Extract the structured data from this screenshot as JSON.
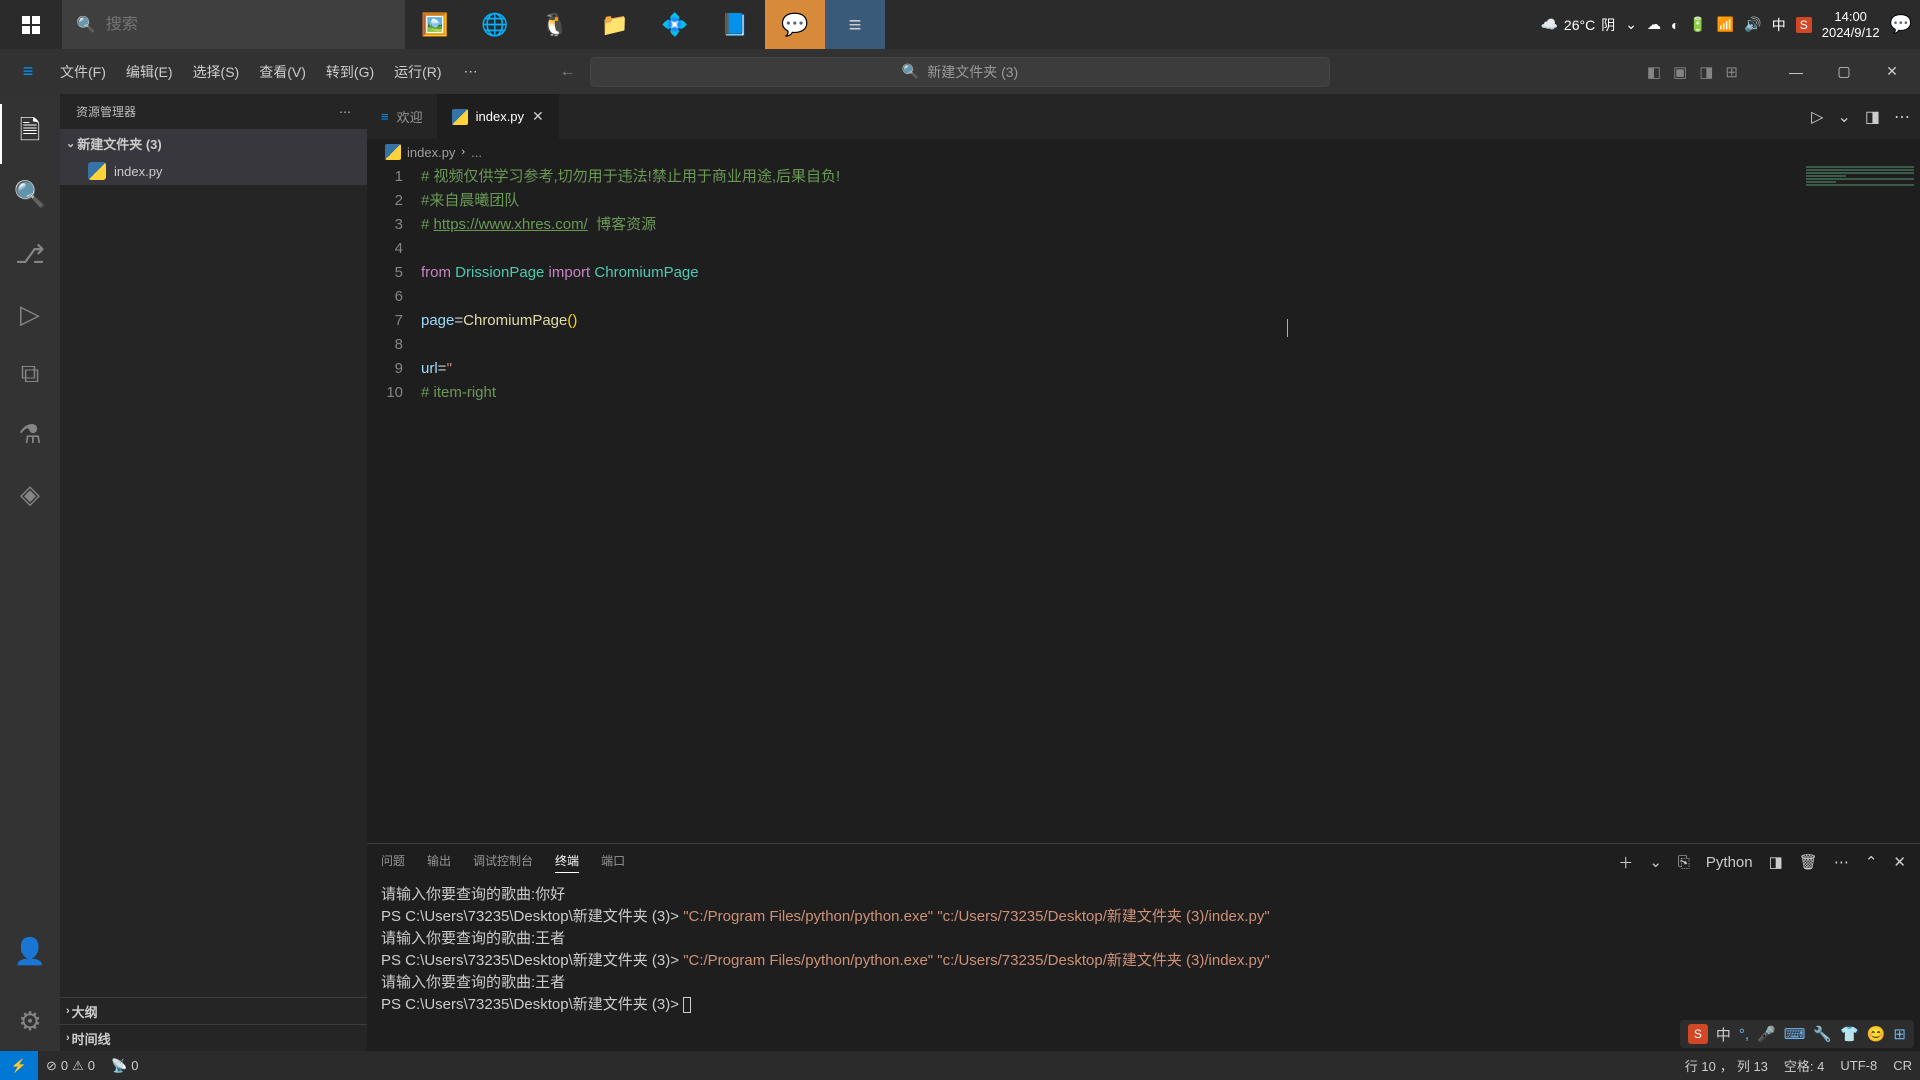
{
  "taskbar": {
    "search_placeholder": "搜索",
    "weather_temp": "26°C",
    "weather_cond": "阴",
    "ime_lang": "中",
    "time": "14:00",
    "date": "2024/9/12"
  },
  "menubar": {
    "items": [
      "文件(F)",
      "编辑(E)",
      "选择(S)",
      "查看(V)",
      "转到(G)",
      "运行(R)"
    ],
    "title_search": "新建文件夹 (3)"
  },
  "sidebar": {
    "header": "资源管理器",
    "folder": "新建文件夹 (3)",
    "file": "index.py",
    "sections": [
      "大纲",
      "时间线"
    ]
  },
  "tabs": {
    "welcome": "欢迎",
    "file": "index.py"
  },
  "breadcrumb": {
    "file": "index.py",
    "more": "..."
  },
  "code": {
    "lines": [
      {
        "n": 1,
        "segments": [
          {
            "t": "# 视频仅供学习参考,切勿用于违法!禁止用于商业用途,后果自负!",
            "c": "c-comment"
          }
        ]
      },
      {
        "n": 2,
        "segments": [
          {
            "t": "#来自晨曦团队",
            "c": "c-comment"
          }
        ]
      },
      {
        "n": 3,
        "segments": [
          {
            "t": "# ",
            "c": "c-comment"
          },
          {
            "t": "https://www.xhres.com/",
            "c": "c-comment c-link"
          },
          {
            "t": "  博客资源",
            "c": "c-comment"
          }
        ]
      },
      {
        "n": 4,
        "segments": []
      },
      {
        "n": 5,
        "segments": [
          {
            "t": "from",
            "c": "c-kw"
          },
          {
            "t": " DrissionPage ",
            "c": "c-module"
          },
          {
            "t": "import",
            "c": "c-kw"
          },
          {
            "t": " ChromiumPage",
            "c": "c-module"
          }
        ]
      },
      {
        "n": 6,
        "segments": []
      },
      {
        "n": 7,
        "segments": [
          {
            "t": "page",
            "c": "c-var"
          },
          {
            "t": "="
          },
          {
            "t": "ChromiumPage",
            "c": "c-fn"
          },
          {
            "t": "()",
            "c": "c-paren"
          }
        ]
      },
      {
        "n": 8,
        "segments": []
      },
      {
        "n": 9,
        "segments": [
          {
            "t": "url",
            "c": "c-var"
          },
          {
            "t": "="
          },
          {
            "t": "''",
            "c": "c-str"
          }
        ]
      },
      {
        "n": 10,
        "segments": [
          {
            "t": "# item-right",
            "c": "c-comment"
          }
        ]
      }
    ]
  },
  "panel": {
    "tabs": [
      "问题",
      "输出",
      "调试控制台",
      "终端",
      "端口"
    ],
    "active_tab": 3,
    "kernel": "Python",
    "terminal": [
      {
        "parts": [
          {
            "t": "请输入你要查询的歌曲:你好"
          }
        ]
      },
      {
        "parts": [
          {
            "t": "PS C:\\Users\\73235\\Desktop\\新建文件夹 (3)> "
          },
          {
            "t": "\"C:/Program Files/python/python.exe\" \"c:/Users/73235/Desktop/新建文件夹 (3)/index.py\"",
            "c": "t-cmd"
          }
        ]
      },
      {
        "parts": [
          {
            "t": "请输入你要查询的歌曲:王者"
          }
        ]
      },
      {
        "parts": [
          {
            "t": "PS C:\\Users\\73235\\Desktop\\新建文件夹 (3)> "
          },
          {
            "t": "\"C:/Program Files/python/python.exe\" \"c:/Users/73235/Desktop/新建文件夹 (3)/index.py\"",
            "c": "t-cmd"
          }
        ]
      },
      {
        "parts": [
          {
            "t": "请输入你要查询的歌曲:王者"
          }
        ]
      },
      {
        "parts": [
          {
            "t": "PS C:\\Users\\73235\\Desktop\\新建文件夹 (3)> "
          }
        ],
        "cursor": true
      }
    ]
  },
  "status": {
    "errors": "0",
    "warnings": "0",
    "ports": "0",
    "line": "行 10",
    "col": "列 13",
    "spaces": "空格: 4",
    "encoding": "UTF-8",
    "eol": "CR",
    "lang": "{"
  },
  "ime": {
    "lang": "中"
  }
}
